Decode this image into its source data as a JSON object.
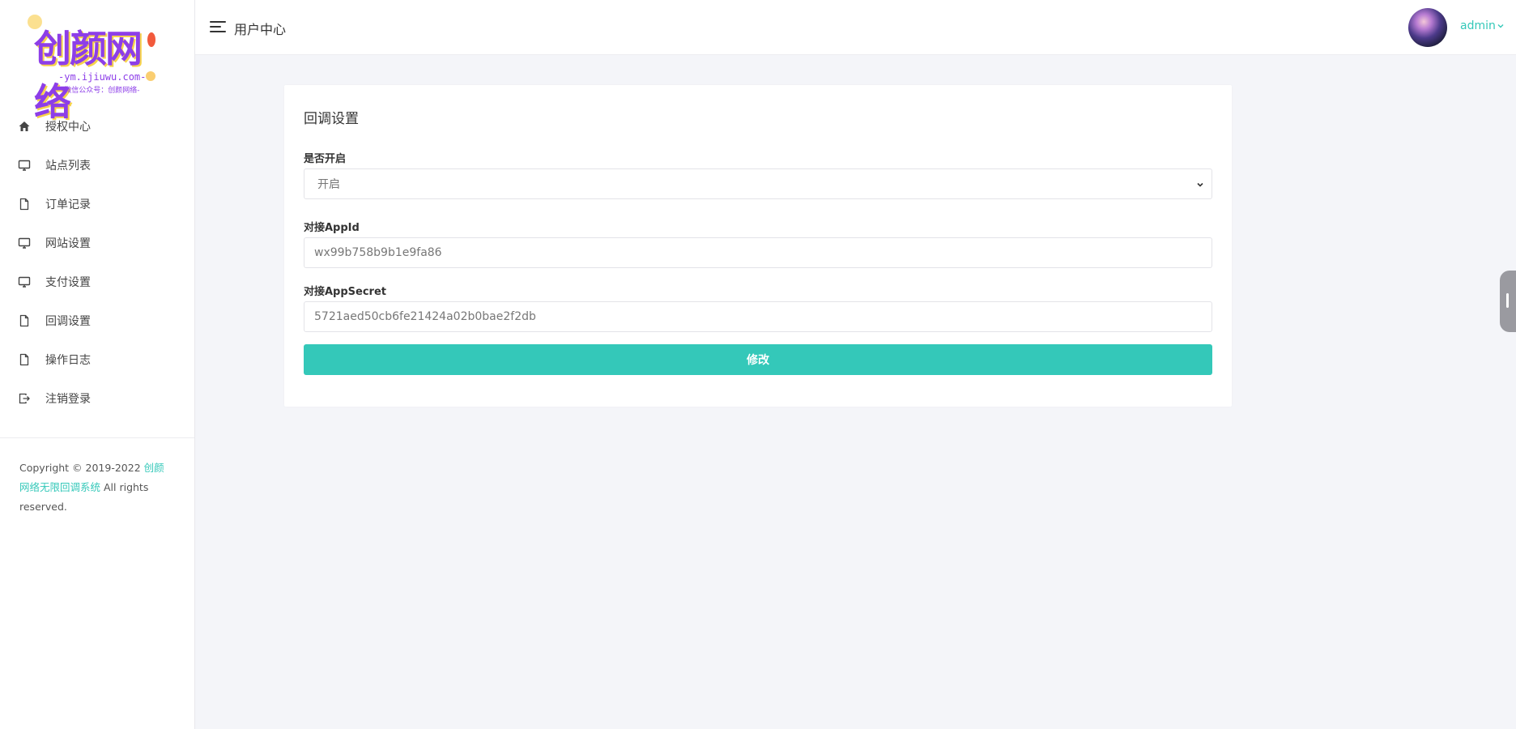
{
  "logo": {
    "main": "创颜网络",
    "url": "-ym.ijiuwu.com-",
    "sub": "-微信公众号：创颜网络-"
  },
  "sidebar": {
    "items": [
      {
        "label": "授权中心",
        "icon": "home-icon"
      },
      {
        "label": "站点列表",
        "icon": "monitor-icon"
      },
      {
        "label": "订单记录",
        "icon": "file-icon"
      },
      {
        "label": "网站设置",
        "icon": "monitor-icon"
      },
      {
        "label": "支付设置",
        "icon": "monitor-icon"
      },
      {
        "label": "回调设置",
        "icon": "file-icon"
      },
      {
        "label": "操作日志",
        "icon": "file-icon"
      },
      {
        "label": "注销登录",
        "icon": "logout-icon"
      }
    ]
  },
  "footer": {
    "prefix": "Copyright © 2019-2022 ",
    "brand": "创颜网络无限回调系统",
    "suffix": " All rights reserved."
  },
  "header": {
    "title": "用户中心",
    "user": "admin"
  },
  "form": {
    "title": "回调设置",
    "enable_label": "是否开启",
    "enable_value": "开启",
    "appid_label": "对接AppId",
    "appid_value": "wx99b758b9b1e9fa86",
    "secret_label": "对接AppSecret",
    "secret_value": "5721aed50cb6fe21424a02b0bae2f2db",
    "submit_label": "修改"
  },
  "colors": {
    "accent": "#34c8b9",
    "logo_purple": "#8d3ee8",
    "background": "#f4f5f9"
  }
}
